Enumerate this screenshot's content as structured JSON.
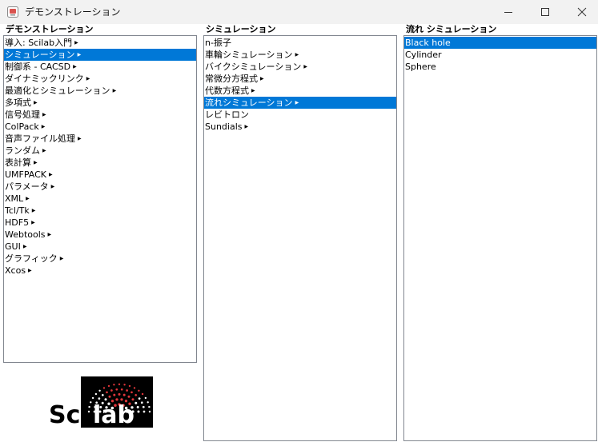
{
  "window": {
    "title": "デモンストレーション"
  },
  "icons": {
    "app": "scilab-app-icon",
    "minimize": "minimize-icon",
    "maximize": "maximize-icon",
    "close": "close-icon",
    "submenu": "submenu-arrow-icon"
  },
  "colors": {
    "selection": "#0078d7",
    "panel_border": "#828790",
    "logo_dot_red": "#e0353a"
  },
  "columns": [
    {
      "label": "デモンストレーション",
      "items": [
        {
          "label": "導入: Scilab入門",
          "submenu": true,
          "selected": false
        },
        {
          "label": "シミュレーション",
          "submenu": true,
          "selected": true
        },
        {
          "label": "制御系 - CACSD",
          "submenu": true,
          "selected": false
        },
        {
          "label": "ダイナミックリンク",
          "submenu": true,
          "selected": false
        },
        {
          "label": "最適化とシミュレーション",
          "submenu": true,
          "selected": false
        },
        {
          "label": "多項式",
          "submenu": true,
          "selected": false
        },
        {
          "label": "信号処理",
          "submenu": true,
          "selected": false
        },
        {
          "label": "ColPack",
          "submenu": true,
          "selected": false
        },
        {
          "label": "音声ファイル処理",
          "submenu": true,
          "selected": false
        },
        {
          "label": "ランダム",
          "submenu": true,
          "selected": false
        },
        {
          "label": "表計算",
          "submenu": true,
          "selected": false
        },
        {
          "label": "UMFPACK",
          "submenu": true,
          "selected": false
        },
        {
          "label": "パラメータ",
          "submenu": true,
          "selected": false
        },
        {
          "label": "XML",
          "submenu": true,
          "selected": false
        },
        {
          "label": "Tcl/Tk",
          "submenu": true,
          "selected": false
        },
        {
          "label": "HDF5",
          "submenu": true,
          "selected": false
        },
        {
          "label": "Webtools",
          "submenu": true,
          "selected": false
        },
        {
          "label": "GUI",
          "submenu": true,
          "selected": false
        },
        {
          "label": "グラフィック",
          "submenu": true,
          "selected": false
        },
        {
          "label": "Xcos",
          "submenu": true,
          "selected": false
        }
      ]
    },
    {
      "label": "シミュレーション",
      "items": [
        {
          "label": "n-振子",
          "submenu": false,
          "selected": false
        },
        {
          "label": "車輪シミュレーション",
          "submenu": true,
          "selected": false
        },
        {
          "label": "バイクシミュレーション",
          "submenu": true,
          "selected": false
        },
        {
          "label": "常微分方程式",
          "submenu": true,
          "selected": false
        },
        {
          "label": "代数方程式",
          "submenu": true,
          "selected": false
        },
        {
          "label": "流れシミュレーション",
          "submenu": true,
          "selected": true
        },
        {
          "label": "レビトロン",
          "submenu": false,
          "selected": false
        },
        {
          "label": "Sundials",
          "submenu": true,
          "selected": false
        }
      ]
    },
    {
      "label": "流れ シミュレーション",
      "items": [
        {
          "label": "Black hole",
          "submenu": false,
          "selected": true
        },
        {
          "label": "Cylinder",
          "submenu": false,
          "selected": false
        },
        {
          "label": "Sphere",
          "submenu": false,
          "selected": false
        }
      ]
    }
  ],
  "logo": {
    "text_part1": "Sci",
    "text_part2": "lab"
  }
}
